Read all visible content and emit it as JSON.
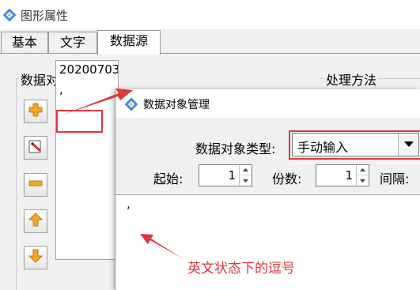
{
  "outer_window": {
    "title": "图形属性",
    "tabs": [
      {
        "label": "基本"
      },
      {
        "label": "文字"
      },
      {
        "label": "数据源",
        "active": true
      }
    ],
    "data_object_group": {
      "label": "数据对象",
      "list_items": [
        "20200703",
        ","
      ]
    },
    "processing_group": {
      "label": "处理方法"
    },
    "tool_icons": [
      "add-icon",
      "edit-icon",
      "remove-icon",
      "move-up-icon",
      "move-down-icon"
    ]
  },
  "dialog": {
    "title": "数据对象管理",
    "type_label": "数据对象类型:",
    "type_value": "手动输入",
    "start_label": "起始:",
    "start_value": "1",
    "copies_label": "份数:",
    "copies_value": "1",
    "interval_label": "间隔:",
    "content": ","
  },
  "annotation": {
    "text": "英文状态下的逗号",
    "color": "#e0353b"
  },
  "colors": {
    "window_bg": "#f0f0f0",
    "accent_red": "#e0353b",
    "icon_orange": "#f5a623"
  }
}
